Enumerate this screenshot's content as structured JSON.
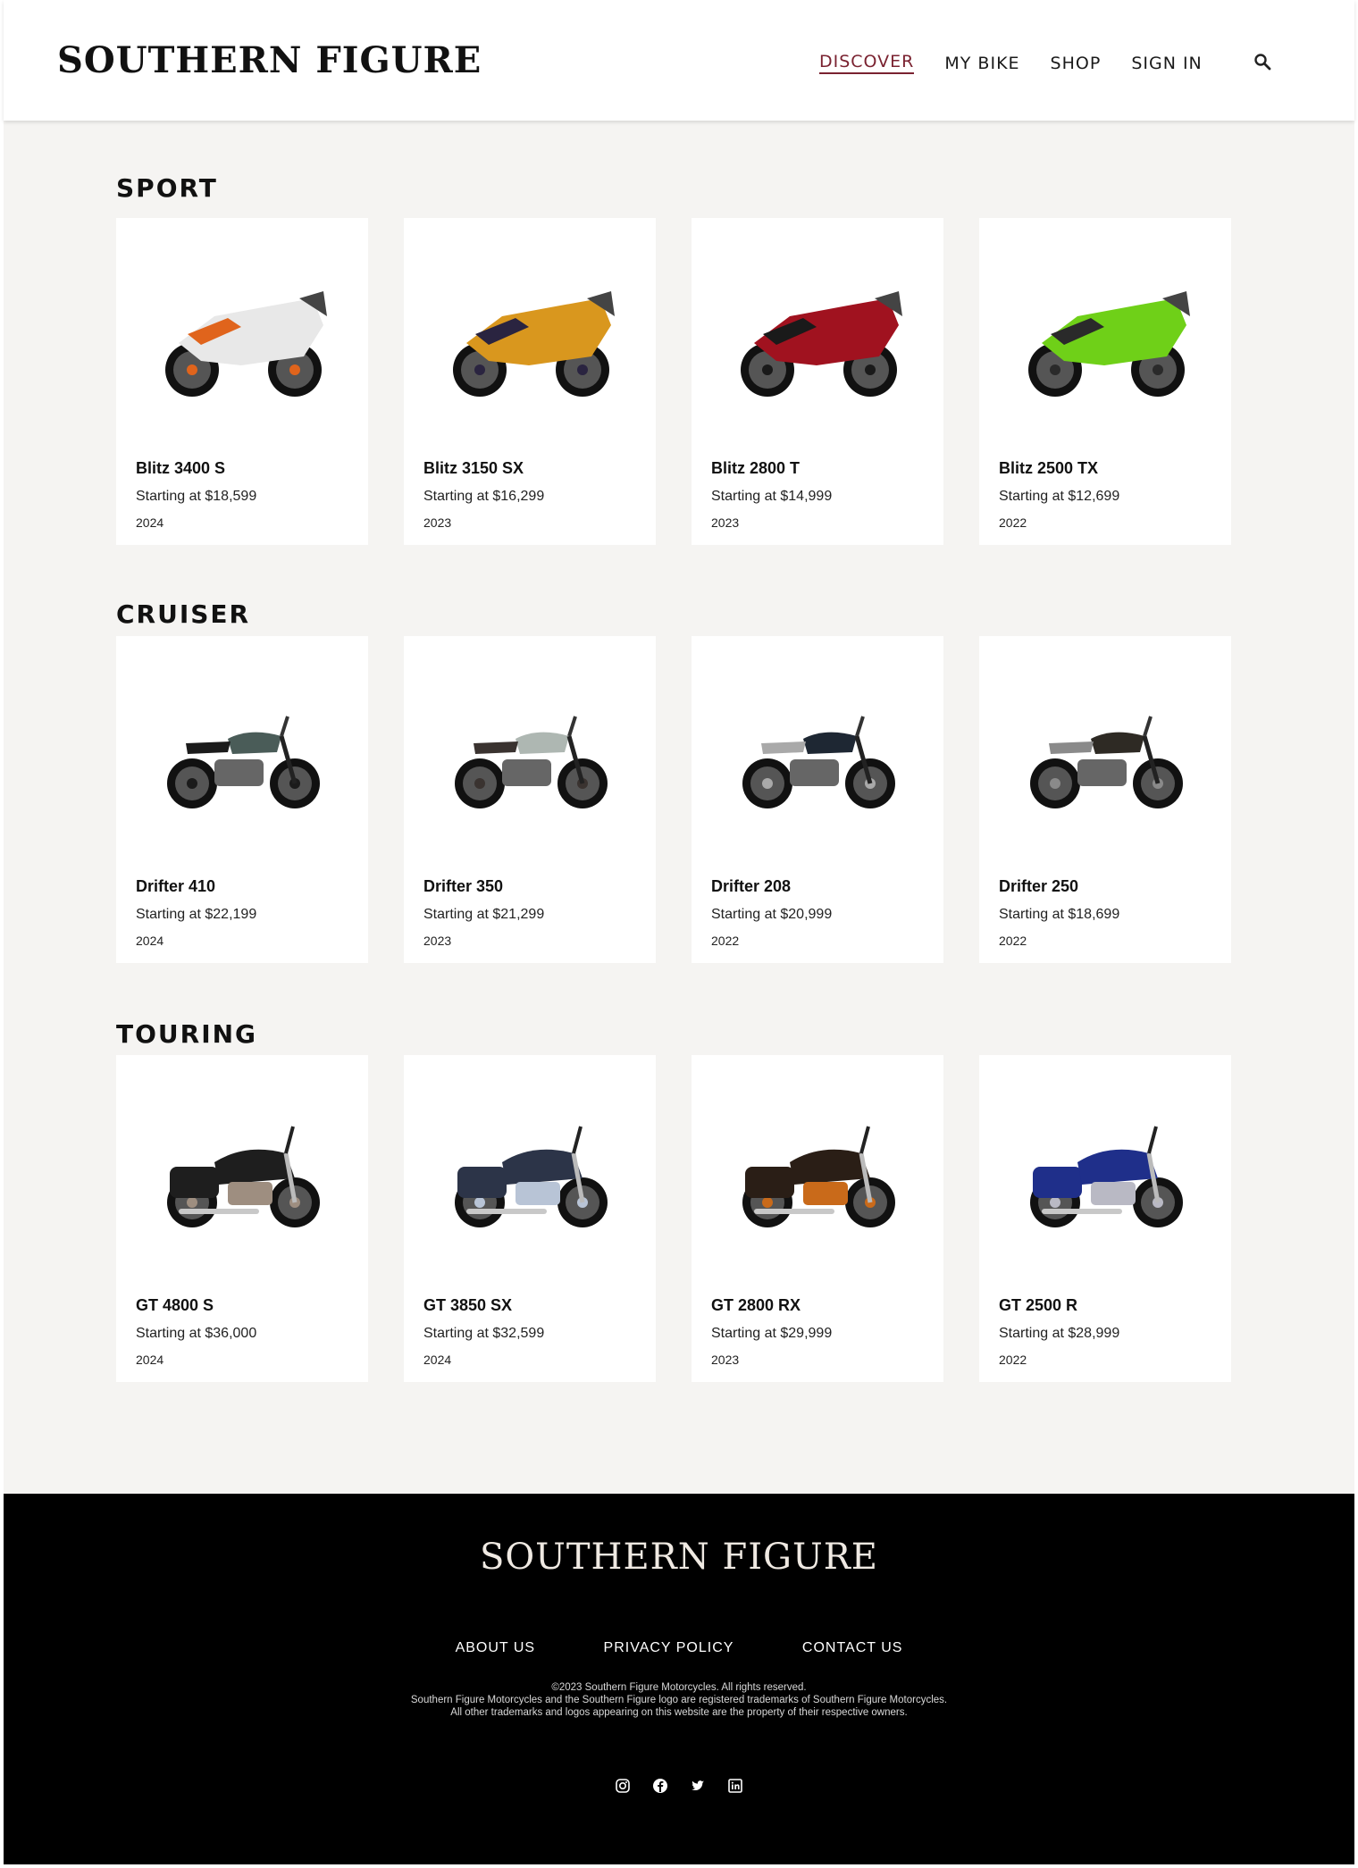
{
  "header": {
    "logo": "SOUTHERN FIGURE",
    "nav": [
      {
        "label": "DISCOVER",
        "active": true
      },
      {
        "label": "MY BIKE"
      },
      {
        "label": "SHOP"
      },
      {
        "label": "SIGN IN"
      }
    ],
    "search_icon": "search-icon"
  },
  "sections": [
    {
      "title": "SPORT",
      "bikes": [
        {
          "name": "Blitz 3400 S",
          "price": "Starting at $18,599",
          "year": "2024",
          "color": "#e8e8e8",
          "accent": "#e0641c"
        },
        {
          "name": "Blitz 3150 SX",
          "price": "Starting at $16,299",
          "year": "2023",
          "color": "#d9971e",
          "accent": "#2a2440"
        },
        {
          "name": "Blitz 2800 T",
          "price": "Starting at $14,999",
          "year": "2023",
          "color": "#a0121f",
          "accent": "#1a1a1a"
        },
        {
          "name": "Blitz 2500 TX",
          "price": "Starting at $12,699",
          "year": "2022",
          "color": "#6fd018",
          "accent": "#2a2a2a"
        }
      ]
    },
    {
      "title": "CRUISER",
      "bikes": [
        {
          "name": "Drifter 410",
          "price": "Starting at $22,199",
          "year": "2024",
          "color": "#4a5c58",
          "accent": "#1b1b1b"
        },
        {
          "name": "Drifter 350",
          "price": "Starting at $21,299",
          "year": "2023",
          "color": "#aeb7b2",
          "accent": "#3a3330"
        },
        {
          "name": "Drifter 208",
          "price": "Starting at $20,999",
          "year": "2022",
          "color": "#1e2733",
          "accent": "#a9a9a9"
        },
        {
          "name": "Drifter 250",
          "price": "Starting at $18,699",
          "year": "2022",
          "color": "#2e2a24",
          "accent": "#8a8a8a"
        }
      ]
    },
    {
      "title": "TOURING",
      "bikes": [
        {
          "name": "GT 4800 S",
          "price": "Starting at $36,000",
          "year": "2024",
          "color": "#1e1e1e",
          "accent": "#9e8e80"
        },
        {
          "name": "GT 3850 SX",
          "price": "Starting at $32,599",
          "year": "2024",
          "color": "#2c3448",
          "accent": "#b8c4d6"
        },
        {
          "name": "GT 2800 RX",
          "price": "Starting at $29,999",
          "year": "2023",
          "color": "#2a1e16",
          "accent": "#c96a1a"
        },
        {
          "name": "GT 2500 R",
          "price": "Starting at $28,999",
          "year": "2022",
          "color": "#1f2f8a",
          "accent": "#b9b9c4"
        }
      ]
    }
  ],
  "footer": {
    "logo": "SOUTHERN FIGURE",
    "links": [
      "ABOUT US",
      "PRIVACY POLICY",
      "CONTACT US"
    ],
    "legal": [
      "©2023 Southern Figure Motorcycles. All rights reserved.",
      "Southern Figure Motorcycles and the Southern Figure logo are registered trademarks of Southern Figure Motorcycles.",
      "All other trademarks and logos appearing on this website are the property of their respective owners."
    ],
    "social": [
      "instagram-icon",
      "facebook-icon",
      "twitter-icon",
      "linkedin-icon"
    ]
  }
}
